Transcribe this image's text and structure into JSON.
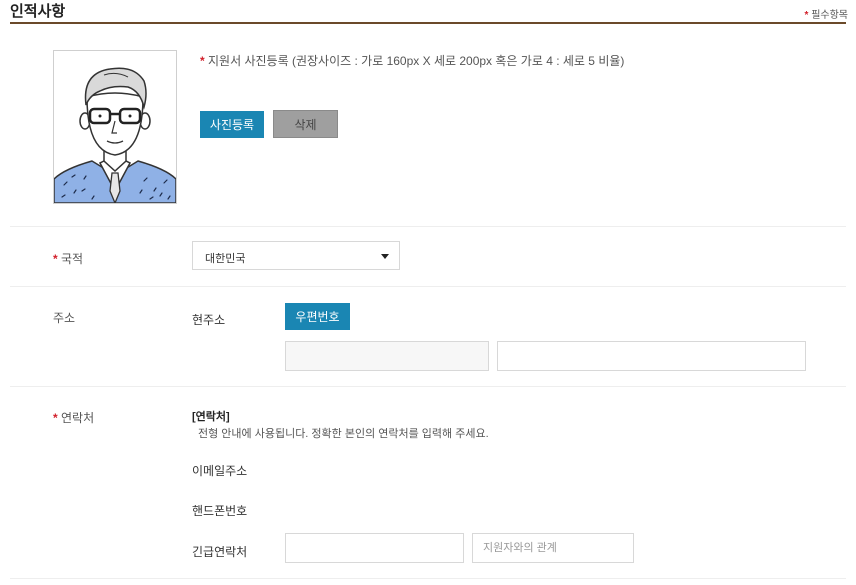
{
  "section": {
    "title": "인적사항",
    "required_mark": "*",
    "required_note": "필수항목"
  },
  "photo": {
    "required_mark": "*",
    "note": "지원서 사진등록 (권장사이즈 : 가로 160px X 세로 200px 혹은 가로 4 : 세로 5 비율)",
    "register_label": "사진등록",
    "delete_label": "삭제",
    "icon": "avatar-placeholder-icon"
  },
  "nationality": {
    "required_mark": "*",
    "label": "국적",
    "selected": "대한민국"
  },
  "address": {
    "label": "주소",
    "current_label": "현주소",
    "zipcode_button": "우편번호"
  },
  "contact": {
    "required_mark": "*",
    "label": "연락처",
    "heading": "[연락처]",
    "description": "전형 안내에 사용됩니다. 정확한 본인의 연락처를 입력해 주세요.",
    "email_label": "이메일주소",
    "phone_label": "핸드폰번호",
    "emergency_label": "긴급연락처",
    "relation_placeholder": "지원자와의 관계"
  },
  "colors": {
    "accent_blue": "#1a86b3",
    "required_red": "#d2202b",
    "title_rule": "#6b4a2a"
  }
}
